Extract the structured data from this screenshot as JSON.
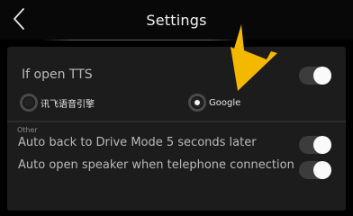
{
  "header": {
    "title": "Settings",
    "back_icon": "chevron-left-icon"
  },
  "tts": {
    "label": "If open TTS",
    "toggle_on": true,
    "engines": [
      {
        "label": "讯飞语音引擎",
        "selected": false
      },
      {
        "label": "Google",
        "selected": true
      }
    ]
  },
  "other": {
    "section_label": "Other",
    "options": [
      {
        "label": "Auto back to Drive Mode 5 seconds later",
        "toggle_on": true
      },
      {
        "label": "Auto open speaker when telephone connection",
        "toggle_on": true
      }
    ]
  },
  "annotation": {
    "icon": "arrow-pointer-icon",
    "color": "#f5b800"
  },
  "colors": {
    "background": "#000000",
    "panel": "#1c1c1c",
    "toggle_track": "#3c3c3c",
    "toggle_knob": "#fafafa"
  }
}
